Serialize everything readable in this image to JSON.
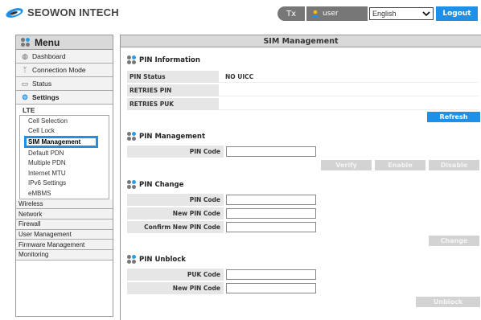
{
  "header": {
    "brand": "SEOWON INTECH",
    "tx_label": "Tx",
    "user_label": "user",
    "language_selected": "English",
    "logout_label": "Logout"
  },
  "sidebar": {
    "menu_title": "Menu",
    "top_items": [
      {
        "label": "Dashboard",
        "icon": "gauge-icon"
      },
      {
        "label": "Connection Mode",
        "icon": "antenna-icon"
      },
      {
        "label": "Status",
        "icon": "monitor-icon"
      },
      {
        "label": "Settings",
        "icon": "gears-icon"
      }
    ],
    "lte_label": "LTE",
    "lte_items": [
      "Cell Selection",
      "Cell Lock",
      "SIM Management",
      "Default PDN",
      "Multiple PDN",
      "Internet MTU",
      "IPv6 Settings",
      "eMBMS"
    ],
    "categories": [
      "Wireless",
      "Network",
      "Firewall",
      "User Management",
      "Firmware Management",
      "Monitoring"
    ]
  },
  "main": {
    "title": "SIM Management",
    "pin_info": {
      "title": "PIN Information",
      "rows": [
        {
          "label": "PIN Status",
          "value": "NO UICC"
        },
        {
          "label": "RETRIES PIN",
          "value": ""
        },
        {
          "label": "RETRIES PUK",
          "value": ""
        }
      ],
      "refresh_label": "Refresh"
    },
    "pin_mgmt": {
      "title": "PIN Management",
      "pin_code_label": "PIN Code",
      "verify_label": "Verify",
      "enable_label": "Enable",
      "disable_label": "Disable"
    },
    "pin_change": {
      "title": "PIN Change",
      "pin_code_label": "PIN Code",
      "new_pin_label": "New PIN Code",
      "confirm_label": "Confirm New PIN Code",
      "change_label": "Change"
    },
    "pin_unblock": {
      "title": "PIN Unblock",
      "puk_label": "PUK Code",
      "new_pin_label": "New PIN Code",
      "unblock_label": "Unblock"
    }
  },
  "colors": {
    "accent": "#1e90e8",
    "header_gray": "#777777",
    "disabled": "#d3d3d3"
  }
}
